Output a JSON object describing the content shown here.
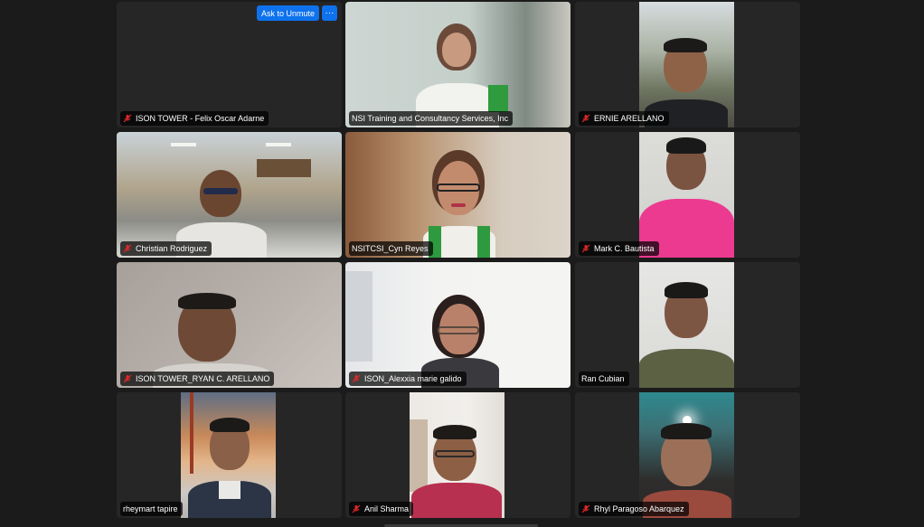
{
  "meeting": {
    "ask_to_unmute_label": "Ask to Unmute",
    "more_label": "···",
    "muted_icon": "muted-mic-icon",
    "active_speaker_color": "#2fce43",
    "accent": "#0e72ed",
    "mute_color": "#e02828"
  },
  "participants": [
    {
      "name": "ISON TOWER - Felix Oscar Adarne",
      "muted": true,
      "video": false
    },
    {
      "name": "NSI Training and Consultancy Services, Inc",
      "muted": false,
      "video": true,
      "active": true
    },
    {
      "name": "ERNIE ARELLANO",
      "muted": true,
      "video": true
    },
    {
      "name": "Christian Rodriguez",
      "muted": true,
      "video": true
    },
    {
      "name": "NSITCSI_Cyn Reyes",
      "muted": false,
      "video": true
    },
    {
      "name": "Mark C. Bautista",
      "muted": true,
      "video": true
    },
    {
      "name": "ISON TOWER_RYAN C. ARELLANO",
      "muted": true,
      "video": true
    },
    {
      "name": "ISON_Alexxia marie galido",
      "muted": true,
      "video": true
    },
    {
      "name": "Ran Cubian",
      "muted": false,
      "video": true
    },
    {
      "name": "rheymart tapire",
      "muted": false,
      "video": true
    },
    {
      "name": "Anil Sharma",
      "muted": true,
      "video": true
    },
    {
      "name": "Rhyl Paragoso Abarquez",
      "muted": true,
      "video": true
    }
  ]
}
